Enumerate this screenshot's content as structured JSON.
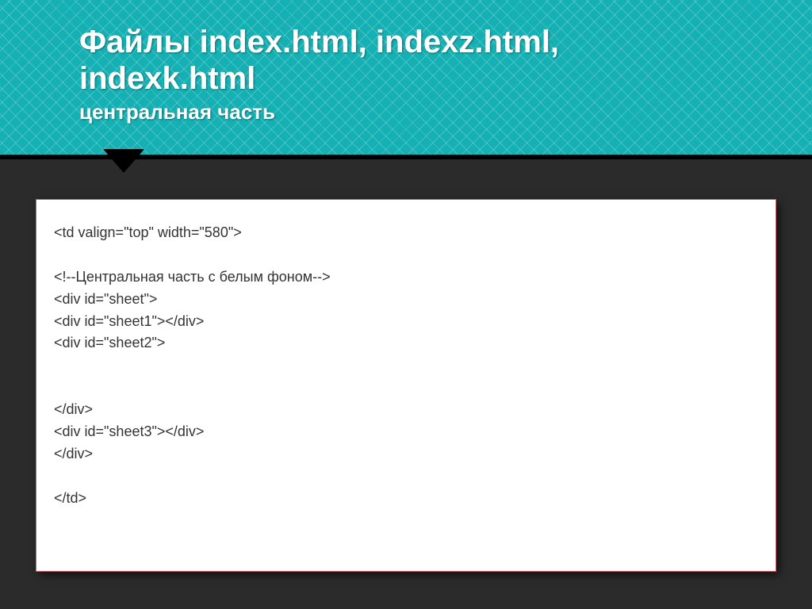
{
  "header": {
    "title_line1": "Файлы index.html, indexz.html,",
    "title_line2": "indexk.html",
    "subtitle": "центральная часть"
  },
  "code": {
    "lines": [
      "<td valign=\"top\" width=\"580\">",
      "",
      "<!--Центральная часть с белым фоном-->",
      "<div id=\"sheet\">",
      "<div id=\"sheet1\"></div>",
      "<div id=\"sheet2\">",
      "",
      "",
      "</div>",
      "<div id=\"sheet3\"></div>",
      "</div>",
      "",
      "</td>"
    ]
  }
}
